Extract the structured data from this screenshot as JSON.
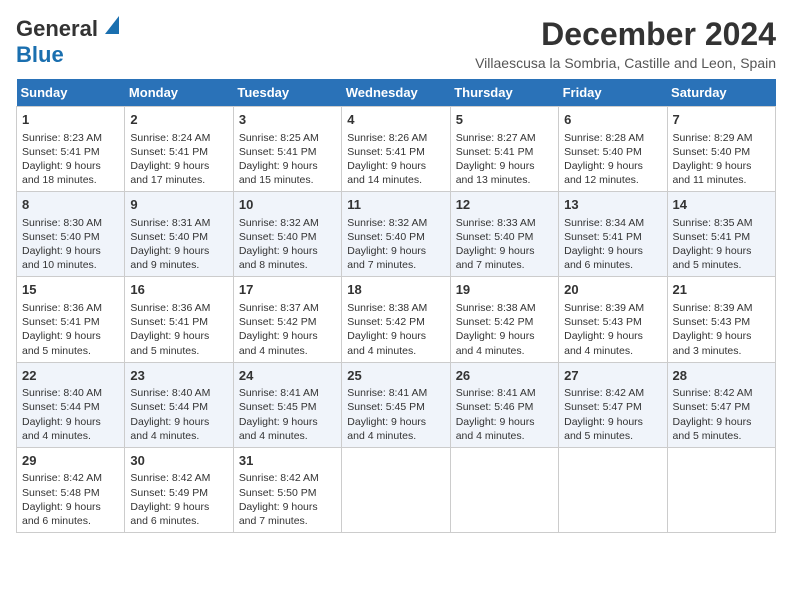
{
  "logo": {
    "general": "General",
    "blue": "Blue"
  },
  "title": "December 2024",
  "subtitle": "Villaescusa la Sombria, Castille and Leon, Spain",
  "headers": [
    "Sunday",
    "Monday",
    "Tuesday",
    "Wednesday",
    "Thursday",
    "Friday",
    "Saturday"
  ],
  "weeks": [
    [
      {
        "day": "1",
        "sunrise": "8:23 AM",
        "sunset": "5:41 PM",
        "daylight": "9 hours and 18 minutes."
      },
      {
        "day": "2",
        "sunrise": "8:24 AM",
        "sunset": "5:41 PM",
        "daylight": "9 hours and 17 minutes."
      },
      {
        "day": "3",
        "sunrise": "8:25 AM",
        "sunset": "5:41 PM",
        "daylight": "9 hours and 15 minutes."
      },
      {
        "day": "4",
        "sunrise": "8:26 AM",
        "sunset": "5:41 PM",
        "daylight": "9 hours and 14 minutes."
      },
      {
        "day": "5",
        "sunrise": "8:27 AM",
        "sunset": "5:41 PM",
        "daylight": "9 hours and 13 minutes."
      },
      {
        "day": "6",
        "sunrise": "8:28 AM",
        "sunset": "5:40 PM",
        "daylight": "9 hours and 12 minutes."
      },
      {
        "day": "7",
        "sunrise": "8:29 AM",
        "sunset": "5:40 PM",
        "daylight": "9 hours and 11 minutes."
      }
    ],
    [
      {
        "day": "8",
        "sunrise": "8:30 AM",
        "sunset": "5:40 PM",
        "daylight": "9 hours and 10 minutes."
      },
      {
        "day": "9",
        "sunrise": "8:31 AM",
        "sunset": "5:40 PM",
        "daylight": "9 hours and 9 minutes."
      },
      {
        "day": "10",
        "sunrise": "8:32 AM",
        "sunset": "5:40 PM",
        "daylight": "9 hours and 8 minutes."
      },
      {
        "day": "11",
        "sunrise": "8:32 AM",
        "sunset": "5:40 PM",
        "daylight": "9 hours and 7 minutes."
      },
      {
        "day": "12",
        "sunrise": "8:33 AM",
        "sunset": "5:40 PM",
        "daylight": "9 hours and 7 minutes."
      },
      {
        "day": "13",
        "sunrise": "8:34 AM",
        "sunset": "5:41 PM",
        "daylight": "9 hours and 6 minutes."
      },
      {
        "day": "14",
        "sunrise": "8:35 AM",
        "sunset": "5:41 PM",
        "daylight": "9 hours and 5 minutes."
      }
    ],
    [
      {
        "day": "15",
        "sunrise": "8:36 AM",
        "sunset": "5:41 PM",
        "daylight": "9 hours and 5 minutes."
      },
      {
        "day": "16",
        "sunrise": "8:36 AM",
        "sunset": "5:41 PM",
        "daylight": "9 hours and 5 minutes."
      },
      {
        "day": "17",
        "sunrise": "8:37 AM",
        "sunset": "5:42 PM",
        "daylight": "9 hours and 4 minutes."
      },
      {
        "day": "18",
        "sunrise": "8:38 AM",
        "sunset": "5:42 PM",
        "daylight": "9 hours and 4 minutes."
      },
      {
        "day": "19",
        "sunrise": "8:38 AM",
        "sunset": "5:42 PM",
        "daylight": "9 hours and 4 minutes."
      },
      {
        "day": "20",
        "sunrise": "8:39 AM",
        "sunset": "5:43 PM",
        "daylight": "9 hours and 4 minutes."
      },
      {
        "day": "21",
        "sunrise": "8:39 AM",
        "sunset": "5:43 PM",
        "daylight": "9 hours and 3 minutes."
      }
    ],
    [
      {
        "day": "22",
        "sunrise": "8:40 AM",
        "sunset": "5:44 PM",
        "daylight": "9 hours and 4 minutes."
      },
      {
        "day": "23",
        "sunrise": "8:40 AM",
        "sunset": "5:44 PM",
        "daylight": "9 hours and 4 minutes."
      },
      {
        "day": "24",
        "sunrise": "8:41 AM",
        "sunset": "5:45 PM",
        "daylight": "9 hours and 4 minutes."
      },
      {
        "day": "25",
        "sunrise": "8:41 AM",
        "sunset": "5:45 PM",
        "daylight": "9 hours and 4 minutes."
      },
      {
        "day": "26",
        "sunrise": "8:41 AM",
        "sunset": "5:46 PM",
        "daylight": "9 hours and 4 minutes."
      },
      {
        "day": "27",
        "sunrise": "8:42 AM",
        "sunset": "5:47 PM",
        "daylight": "9 hours and 5 minutes."
      },
      {
        "day": "28",
        "sunrise": "8:42 AM",
        "sunset": "5:47 PM",
        "daylight": "9 hours and 5 minutes."
      }
    ],
    [
      {
        "day": "29",
        "sunrise": "8:42 AM",
        "sunset": "5:48 PM",
        "daylight": "9 hours and 6 minutes."
      },
      {
        "day": "30",
        "sunrise": "8:42 AM",
        "sunset": "5:49 PM",
        "daylight": "9 hours and 6 minutes."
      },
      {
        "day": "31",
        "sunrise": "8:42 AM",
        "sunset": "5:50 PM",
        "daylight": "9 hours and 7 minutes."
      },
      null,
      null,
      null,
      null
    ]
  ],
  "labels": {
    "sunrise": "Sunrise:",
    "sunset": "Sunset:",
    "daylight": "Daylight:"
  }
}
